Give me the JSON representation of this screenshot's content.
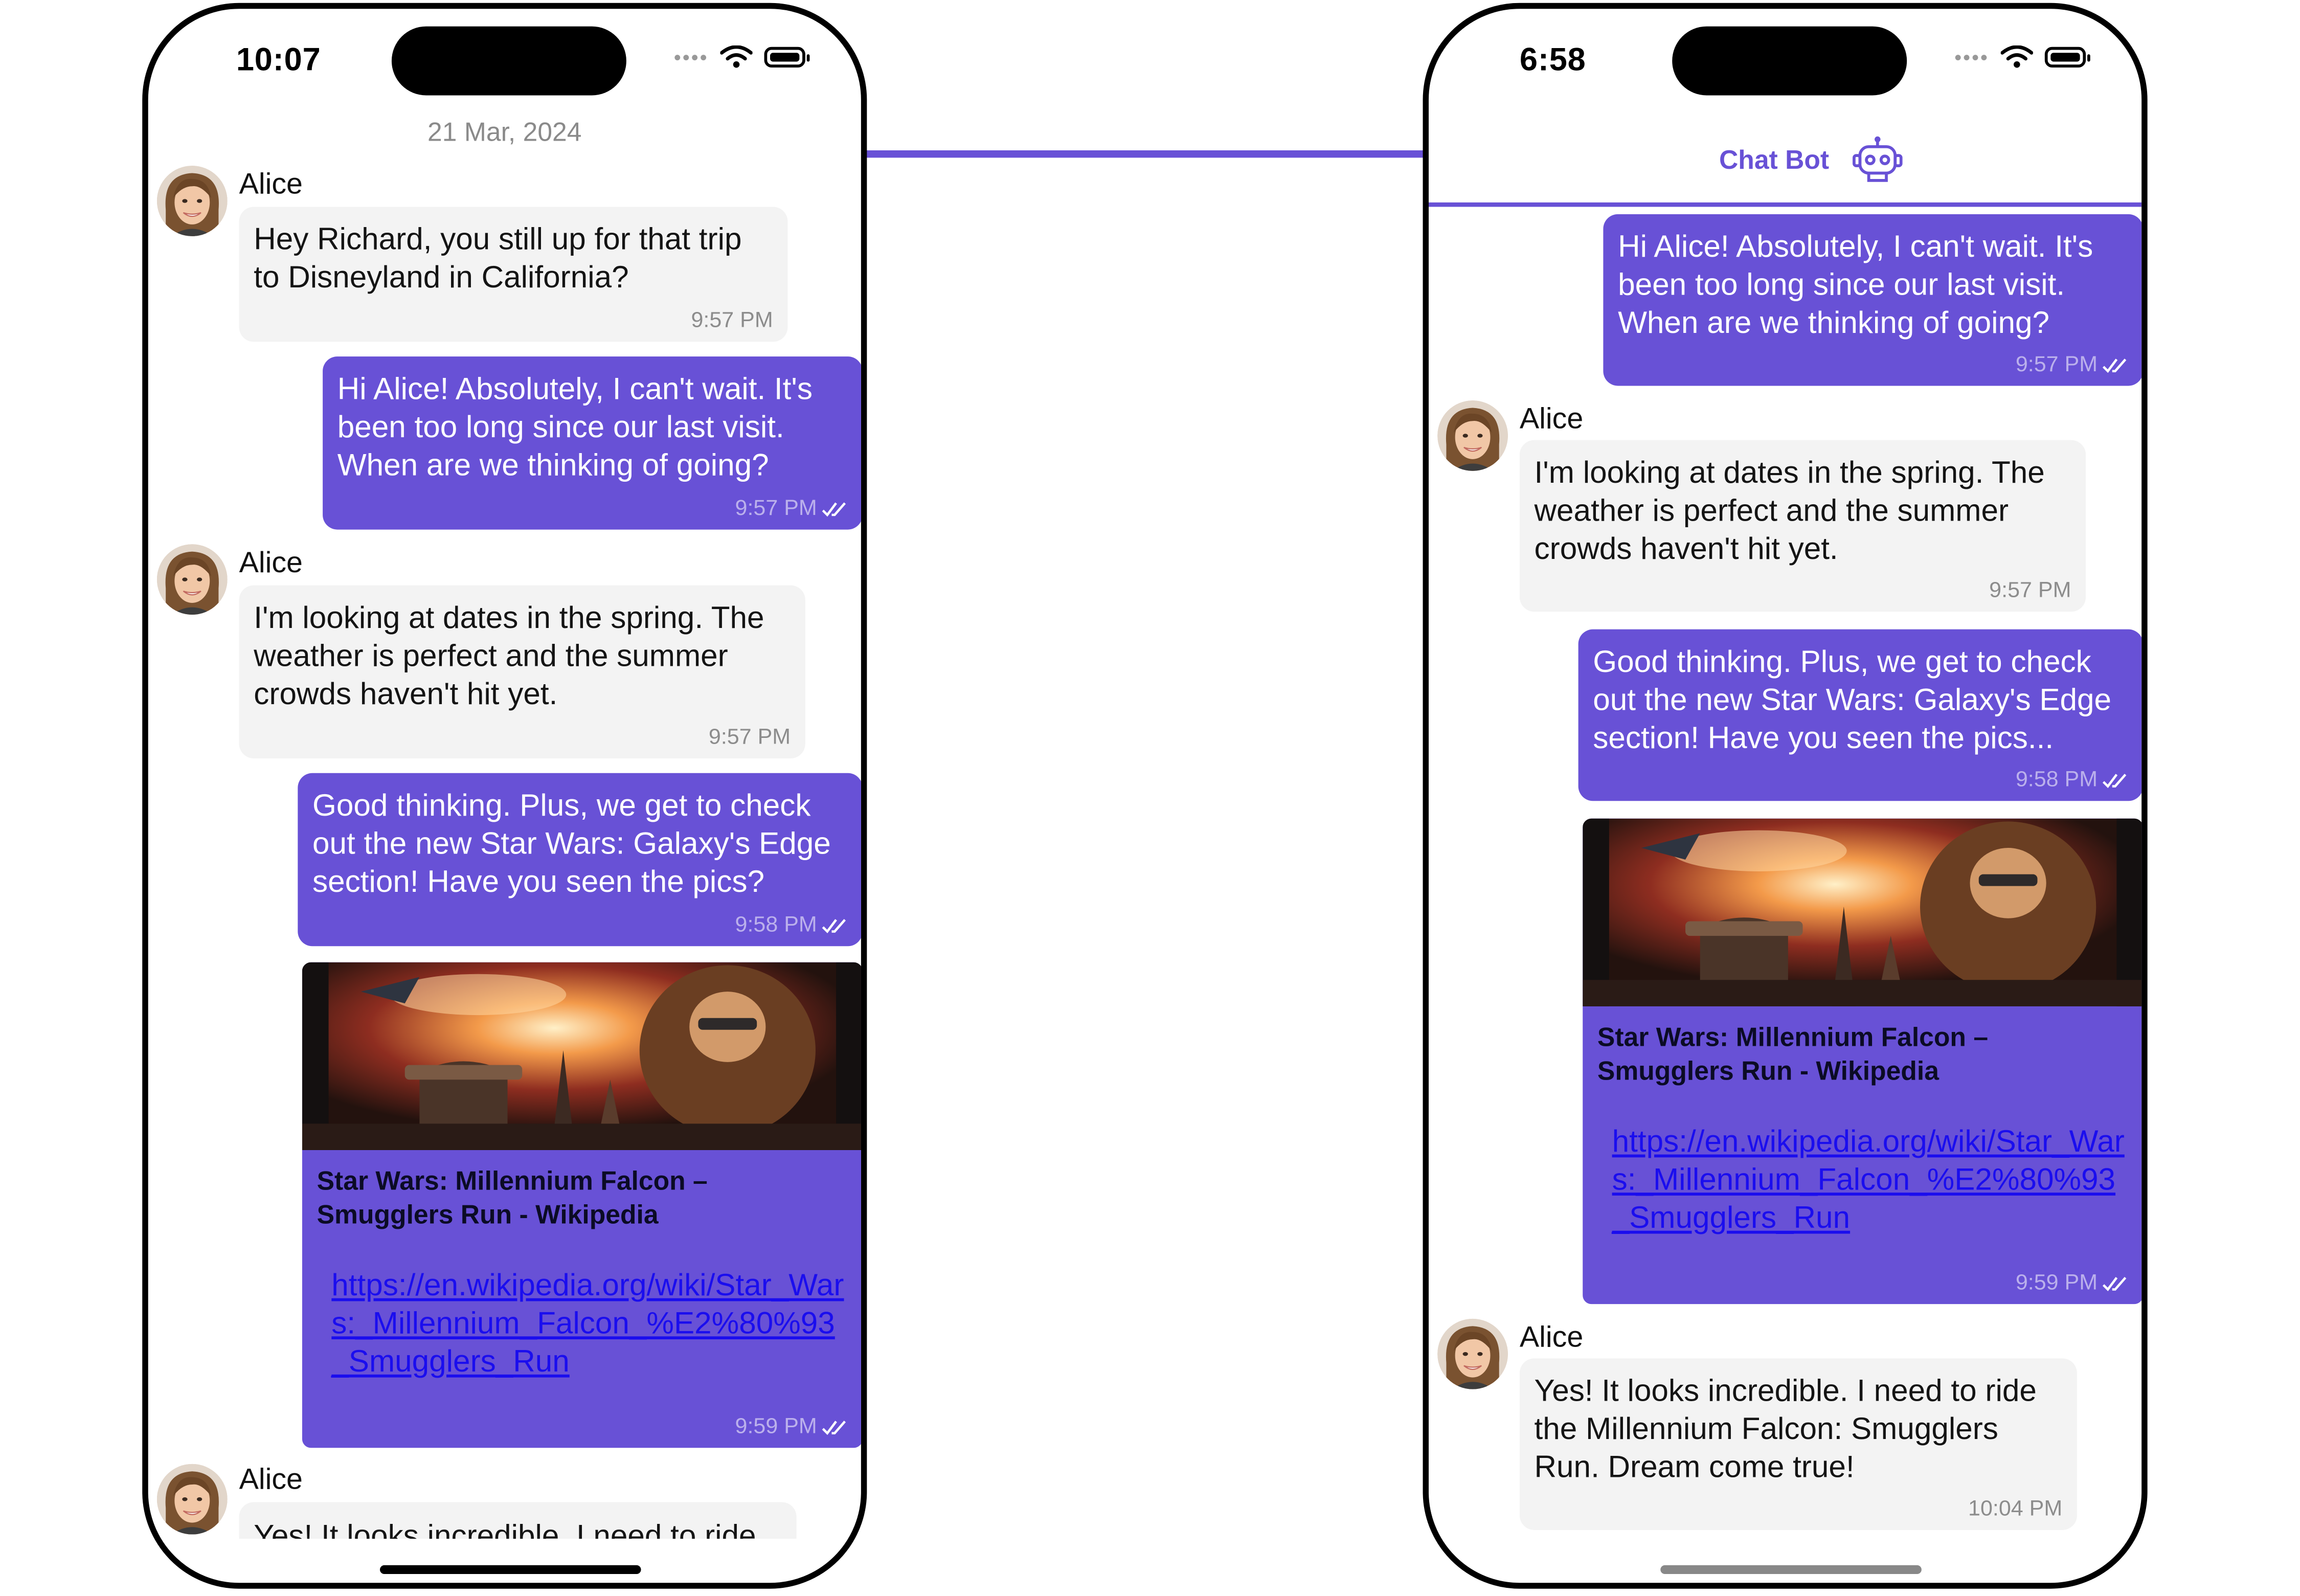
{
  "colors": {
    "accent": "#6851d6",
    "incoming_bubble": "#f3f3f3",
    "link": "#1a0dee"
  },
  "left_screen": {
    "status_time": "10:07",
    "date_separator": "21 Mar, 2024",
    "messages": [
      {
        "sender": "Alice",
        "text": "Hey Richard, you still up for that trip to Disneyland in California?",
        "time": "9:57 PM"
      },
      {
        "text": "Hi Alice! Absolutely, I can't wait. It's been too long since our last visit. When are we thinking of going?",
        "time": "9:57 PM"
      },
      {
        "sender": "Alice",
        "text": "I'm looking at dates in the spring. The weather is perfect and the summer crowds haven't hit yet.",
        "time": "9:57 PM"
      },
      {
        "text": "Good thinking. Plus, we get to check out the new Star Wars: Galaxy's Edge section! Have you seen the pics?",
        "time": "9:58 PM"
      },
      {
        "link_title": "Star Wars: Millennium Falcon – Smugglers Run - Wikipedia",
        "link_url": "https://en.wikipedia.org/wiki/Star_Wars:_Millennium_Falcon_%E2%80%93_Smugglers_Run",
        "time": "9:59 PM"
      },
      {
        "sender": "Alice",
        "text": "Yes! It looks incredible. I need to ride"
      }
    ]
  },
  "right_screen": {
    "status_time": "6:58",
    "header_title": "Chat Bot",
    "header_icon": "robot-icon",
    "messages": [
      {
        "text": "Hi Alice! Absolutely, I can't wait. It's been too long since our last visit. When are we thinking of going?",
        "time": "9:57 PM"
      },
      {
        "sender": "Alice",
        "text": "I'm looking at dates in the spring. The weather is perfect and the summer crowds haven't hit yet.",
        "time": "9:57 PM"
      },
      {
        "text": "Good thinking. Plus, we get to check out the new Star Wars: Galaxy's Edge section! Have you seen the pics...",
        "time": "9:58 PM"
      },
      {
        "link_title": "Star Wars: Millennium Falcon – Smugglers Run - Wikipedia",
        "link_url": "https://en.wikipedia.org/wiki/Star_Wars:_Millennium_Falcon_%E2%80%93_Smugglers_Run",
        "time": "9:59 PM"
      },
      {
        "sender": "Alice",
        "text": "Yes! It looks incredible. I need to ride the Millennium Falcon: Smugglers Run. Dream come true!",
        "time": "10:04 PM"
      }
    ]
  }
}
